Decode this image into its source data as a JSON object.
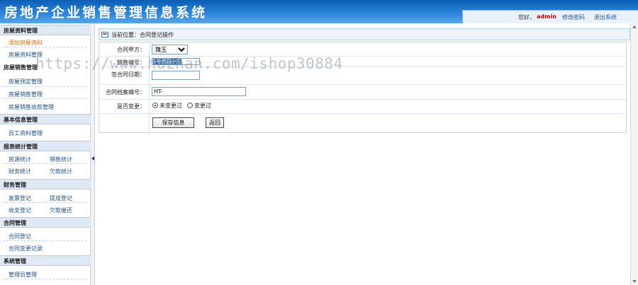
{
  "app": {
    "title": "房地产企业销售管理信息系统"
  },
  "header": {
    "greeting": "您好，",
    "username": "admin",
    "change_password": "修改密码",
    "logout": "退出系统"
  },
  "sidebar": {
    "groups": [
      {
        "title": "房屋资料管理",
        "items": [
          "添加房屋资料",
          "房屋资料管理"
        ]
      },
      {
        "title": "房屋销售管理",
        "items": [
          "房屋预定管理",
          "房屋销售管理",
          "房屋销售收款管理"
        ]
      },
      {
        "title": "基本信息管理",
        "items": [
          "员工资料管理"
        ]
      },
      {
        "title": "报表统计管理",
        "items": [
          "房源统计",
          "销售统计",
          "财务统计",
          "欠款统计"
        ]
      },
      {
        "title": "财务管理",
        "items": [
          "发票登记",
          "提成登记",
          "收支登记",
          "欠款催还"
        ]
      },
      {
        "title": "合同管理",
        "items": [
          "合同登记",
          "合同变更记录"
        ]
      },
      {
        "title": "系统管理",
        "items": [
          "管理员管理"
        ]
      }
    ]
  },
  "breadcrumb": {
    "text": "当前位置：合同登记操作"
  },
  "form": {
    "party_a": {
      "label": "合同甲方：",
      "value": "魏玉"
    },
    "sales_no": {
      "label": "销售编号：",
      "value": "1号西园小区"
    },
    "sign_date": {
      "label": "签合同日期：",
      "value": ""
    },
    "archive_no": {
      "label": "合同档案编号：",
      "value": "HT-"
    },
    "changed": {
      "label": "是否变更：",
      "options": [
        "未变更过",
        "变更过"
      ],
      "selected": "未变更过"
    },
    "save_label": "保存信息",
    "back_label": "返回"
  },
  "watermark": {
    "text": "https://www.huzhan.com/ishop30884"
  }
}
